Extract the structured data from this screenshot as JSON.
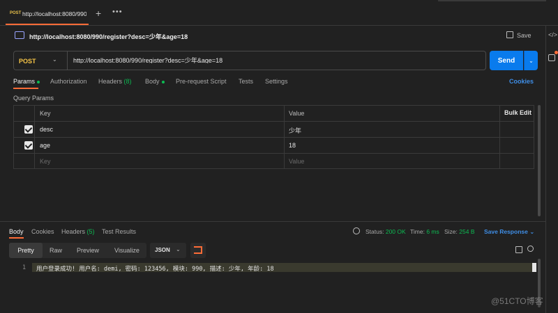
{
  "tabbar": {
    "tab_method": "POST",
    "tab_title": "http://localhost:8080/990",
    "plus": "+",
    "more": "•••"
  },
  "rail": {
    "code_icon": "</>"
  },
  "request": {
    "title": "http://localhost:8080/990/register?desc=少年&age=18",
    "save_label": "Save",
    "method": "POST",
    "url": "http://localhost:8080/990/register?desc=少年&age=18",
    "send_label": "Send"
  },
  "request_tabs": {
    "params": "Params",
    "authorization": "Authorization",
    "headers": "Headers",
    "headers_count": "(8)",
    "body": "Body",
    "prerequest": "Pre-request Script",
    "tests": "Tests",
    "settings": "Settings",
    "cookies": "Cookies"
  },
  "query_params": {
    "label": "Query Params",
    "col_key": "Key",
    "col_value": "Value",
    "bulk_edit": "Bulk Edit",
    "rows": [
      {
        "key": "desc",
        "value": "少年",
        "checked": true
      },
      {
        "key": "age",
        "value": "18",
        "checked": true
      }
    ],
    "placeholder_key": "Key",
    "placeholder_value": "Value"
  },
  "response_tabs": {
    "body": "Body",
    "cookies": "Cookies",
    "headers": "Headers",
    "headers_count": "(5)",
    "test_results": "Test Results"
  },
  "response_meta": {
    "status_label": "Status:",
    "status_value": "200 OK",
    "time_label": "Time:",
    "time_value": "6 ms",
    "size_label": "Size:",
    "size_value": "254 B",
    "save_response": "Save Response"
  },
  "response_view": {
    "pretty": "Pretty",
    "raw": "Raw",
    "preview": "Preview",
    "visualize": "Visualize",
    "format": "JSON"
  },
  "response_body": {
    "line_number": "1",
    "text": "用户登录成功! 用户名: demi, 密码: 123456, 模块: 990, 描述: 少年, 年龄: 18"
  },
  "watermark": "@51CTO博客",
  "colors": {
    "accent": "#ff6c37",
    "send": "#097bed",
    "status_ok": "#0cbb52",
    "method_post": "#f7c547",
    "link": "#3f8ee6"
  }
}
